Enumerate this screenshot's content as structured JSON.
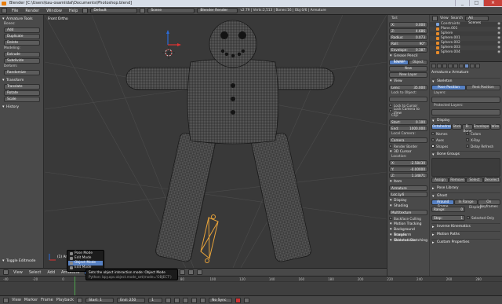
{
  "window": {
    "title": "Blender [C:\\Users\\kau-osamiidal\\Documents\\Photoshop.blend]",
    "minimize": "_",
    "maximize": "□",
    "close": "×"
  },
  "infobar": {
    "menus": [
      "File",
      "Render",
      "Window",
      "Help"
    ],
    "screen": "Default",
    "scene": "Scene",
    "engine": "Blender Render",
    "stats": "v2.79 | Verts:2,513 | Bones:16 | Obj:0/6 | Armature"
  },
  "toolshelf": {
    "header": "Armature Tools",
    "groups": [
      {
        "label": "Bones:",
        "buttons": [
          "Add",
          "Duplicate",
          "Delete"
        ]
      },
      {
        "label": "Modeling:",
        "buttons": [
          "Extrude",
          "Subdivide"
        ]
      },
      {
        "label": "Deform:",
        "buttons": [
          "Randomize"
        ]
      }
    ],
    "transform": {
      "header": "Transform",
      "buttons": [
        "Translate",
        "Rotate",
        "Scale"
      ]
    },
    "history": "History",
    "footer": "Toggle Editmode"
  },
  "viewport": {
    "label": "Front Ortho",
    "corner_label": "(1) Armature"
  },
  "view_header": {
    "menus": [
      "View",
      "Select",
      "Add",
      "Armature"
    ],
    "mode": "Object Mode",
    "global": "Global"
  },
  "npanel": {
    "bone_fields": [
      {
        "k": "Tail:",
        "v": ""
      },
      {
        "k": "X:",
        "v": "0.000"
      },
      {
        "k": "Z:",
        "v": "4.686"
      },
      {
        "k": "Radius:",
        "v": "0.073"
      },
      {
        "k": "Roll:",
        "v": "90°"
      },
      {
        "k": "Envelope:",
        "v": "0.387"
      }
    ],
    "grease_header": "Grease Pencil Layers",
    "grease_tabs": [
      "Scene",
      "Object"
    ],
    "grease_new": "New",
    "grease_new_layer": "New Layer",
    "view_header": "View",
    "lens": {
      "k": "Lens:",
      "v": "35.000"
    },
    "lock_to_object": "Lock to Object:",
    "lock_cursor": "Lock to Cursor",
    "lock_camera": "Lock Camera to View",
    "clip": "Clip:",
    "clip_start": {
      "k": "Start:",
      "v": "0.100"
    },
    "clip_end": {
      "k": "End:",
      "v": "1000.000"
    },
    "local_camera": "Local Camera:",
    "camera_field": "Camera",
    "render_border": "Render Border",
    "cursor_header": "3D Cursor",
    "location": "Location:",
    "cursor_x": {
      "k": "X:",
      "v": "-2.58430"
    },
    "cursor_y": {
      "k": "Y:",
      "v": "-0.00000"
    },
    "cursor_z": {
      "k": "Z:",
      "v": "1.34871"
    },
    "item_header": "Item",
    "item_name": "Armature",
    "item_sub": "Loc.Ly.6",
    "display_header": "Display",
    "shading_header": "Shading",
    "shading_mode": "Multitexture",
    "shading_opts": [
      "Backface Culling"
    ],
    "motion_tracking": "Motion Tracking",
    "background_images": "Background Images",
    "transform_orient": "Transform Orientations",
    "skeleton_sketching": "Skeleton Sketching"
  },
  "outliner": {
    "view": "View",
    "search": "Search",
    "scope": "All Scenes",
    "rows": [
      "Constraints",
      "Plane.001",
      "Sphere",
      "Sphere.001",
      "Sphere.002",
      "Sphere.003",
      "Sphere.004"
    ]
  },
  "props": {
    "path": "Armature",
    "path2": "Armature",
    "skeleton": "Skeleton",
    "pose_position": "Pose Position",
    "rest_position": "Rest Position",
    "layers": "Layers:",
    "protected_layers": "Protected Layers:",
    "display": "Display",
    "display_modes": [
      "Octahedral",
      "Stick",
      "B-Bone",
      "Envelope",
      "Wire"
    ],
    "display_opts": [
      {
        "label": "Names",
        "on": false
      },
      {
        "label": "Colors",
        "on": false
      },
      {
        "label": "Axes",
        "on": false
      },
      {
        "label": "X-Ray",
        "on": false
      },
      {
        "label": "Shapes",
        "on": true
      },
      {
        "label": "Delay Refresh",
        "on": false
      }
    ],
    "bone_groups": "Bone Groups",
    "assign": "Assign",
    "remove": "Remove",
    "select": "Select",
    "deselect": "Deselect",
    "pose_library": "Pose Library",
    "ghost": "Ghost",
    "ghost_modes": [
      "Around Frame",
      "In Range",
      "On Keyframes"
    ],
    "ghost_range": {
      "k": "Range:",
      "v": "0"
    },
    "ghost_step": {
      "k": "Step:",
      "v": "1"
    },
    "ghost_display": "Display:",
    "selected_only": "Selected Only",
    "inverse_kinematics": "Inverse Kinematics",
    "motion_paths": "Motion Paths",
    "custom_properties": "Custom Properties"
  },
  "popup": {
    "items": [
      "Pose Mode",
      "Edit Mode",
      "Object Mode",
      "Edit Mode"
    ],
    "highlight_index": 2
  },
  "tooltip": {
    "line1": "Sets the object interaction mode:  Object Mode",
    "line2": "Python: bpy.ops.object.mode_set(mode='OBJECT')"
  },
  "timeline": {
    "ticks": [
      "-40",
      "-20",
      "0",
      "20",
      "40",
      "60",
      "80",
      "100",
      "120",
      "140",
      "160",
      "180",
      "200",
      "220",
      "240",
      "260",
      "280"
    ],
    "menus": [
      "View",
      "Marker",
      "Frame",
      "Playback"
    ],
    "start": {
      "k": "Start:",
      "v": "1"
    },
    "end": {
      "k": "End:",
      "v": "250"
    },
    "current": "1",
    "sync": "No Sync"
  },
  "colors": {
    "accent": "#5680c2",
    "bone": "#e8a33a",
    "wire": "#111111"
  }
}
